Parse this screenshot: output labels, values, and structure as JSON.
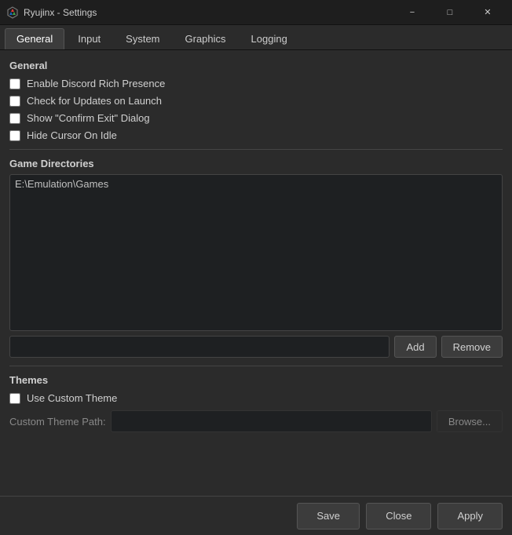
{
  "titlebar": {
    "title": "Ryujinx - Settings",
    "minimize_label": "−",
    "maximize_label": "□",
    "close_label": "✕"
  },
  "tabs": [
    {
      "id": "general",
      "label": "General",
      "active": true
    },
    {
      "id": "input",
      "label": "Input",
      "active": false
    },
    {
      "id": "system",
      "label": "System",
      "active": false
    },
    {
      "id": "graphics",
      "label": "Graphics",
      "active": false
    },
    {
      "id": "logging",
      "label": "Logging",
      "active": false
    }
  ],
  "general_section": {
    "title": "General",
    "checkboxes": [
      {
        "id": "discord",
        "label": "Enable Discord Rich Presence",
        "checked": false
      },
      {
        "id": "updates",
        "label": "Check for Updates on Launch",
        "checked": false
      },
      {
        "id": "confirmexit",
        "label": "Show \"Confirm Exit\" Dialog",
        "checked": false
      },
      {
        "id": "hidecursor",
        "label": "Hide Cursor On Idle",
        "checked": false
      }
    ]
  },
  "game_directories": {
    "title": "Game Directories",
    "entries": [
      "E:\\Emulation\\Games"
    ],
    "add_label": "Add",
    "remove_label": "Remove",
    "input_placeholder": ""
  },
  "themes": {
    "title": "Themes",
    "use_custom_label": "Use Custom Theme",
    "use_custom_checked": false,
    "path_label": "Custom Theme Path:",
    "path_placeholder": "",
    "browse_label": "Browse..."
  },
  "footer": {
    "save_label": "Save",
    "close_label": "Close",
    "apply_label": "Apply"
  }
}
